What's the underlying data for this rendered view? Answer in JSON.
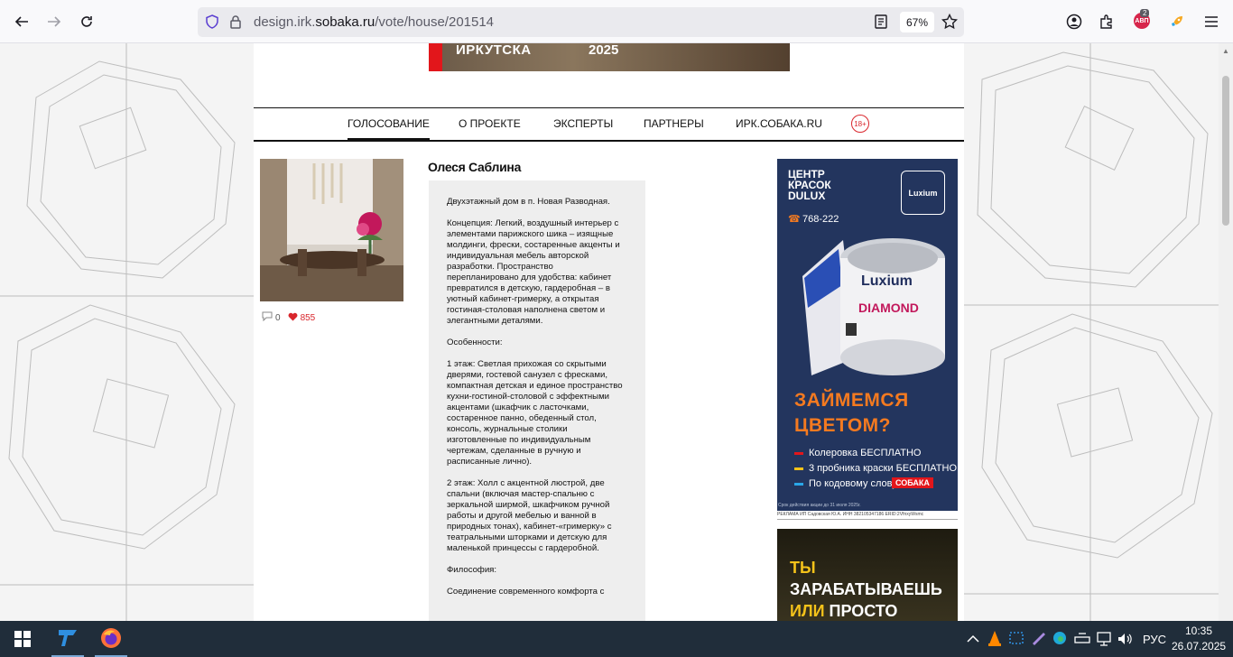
{
  "browser": {
    "url_prefix": "design.irk.",
    "url_domain": "sobaka.ru",
    "url_path": "/vote/house/201514",
    "zoom": "67%",
    "extension_badge": "АВП",
    "extension_count": "2"
  },
  "banner": {
    "text": "ИРКУТСКА",
    "year": "2025"
  },
  "nav": {
    "items": [
      "ГОЛОСОВАНИЕ",
      "О ПРОЕКТЕ",
      "ЭКСПЕРТЫ",
      "ПАРТНЕРЫ",
      "ИРК.СОБАКА.RU"
    ],
    "age": "18+"
  },
  "entry": {
    "author": "Олеся Саблина",
    "comments": "0",
    "likes": "855",
    "paragraphs": [
      "Двухэтажный дом в п. Новая Разводная.",
      "Концепция: Легкий, воздушный интерьер с элементами парижского шика – изящные молдинги, фрески, состаренные акценты и индивидуальная мебель авторской разработки. Пространство перепланировано для удобства: кабинет превратился в детскую, гардеробная – в уютный кабинет-гримерку, а открытая гостиная-столовая наполнена светом и элегантными деталями.",
      "Особенности:",
      "1 этаж: Светлая прихожая со скрытыми дверями, гостевой санузел с фресками, компактная детская и единое пространство кухни-гостиной-столовой с эффектными акцентами (шкафчик с ласточками, состаренное панно, обеденный стол, консоль, журнальные столики изготовленные по индивидуальным чертежам, сделанные в ручную и расписанные лично).",
      "2 этаж: Холл с акцентной люстрой, две спальни (включая мастер-спальню с зеркальной ширмой, шкафчиком ручной работы и другой мебелью и ванной в природных тонах), кабинет-«гримерку» с театральными шторками и детскую для маленькой принцессы с гардеробной.",
      "Философия:",
      "Соединение современного комфорта с"
    ]
  },
  "ad1": {
    "brand_line1": "ЦЕНТР",
    "brand_line2": "КРАСОК",
    "brand_line3": "DULUX",
    "phone": "768-222",
    "logo": "Luxium",
    "can_brand": "Luxium",
    "can_product": "DIAMOND",
    "headline_line1": "ЗАЙМЕМСЯ",
    "headline_line2": "ЦВЕТОМ?",
    "bullets": [
      "Колеровка БЕСПЛАТНО",
      "3 пробника краски БЕСПЛАТНО",
      "По кодовому слову"
    ],
    "sobaka": "СОБАКА",
    "fineprint": "Срок действия акции до 31 июля 2025г.",
    "caption": "РЕКЛАМА ИП Садовская Ю.А. ИНН 382105347186 ERID:2VfnxyWsmc",
    "colors": {
      "bg": "#23355e",
      "accent": "#f47a20",
      "red": "#e2161b"
    }
  },
  "ad2": {
    "line1": "ТЫ ЗАРАБАТЫВАЕШЬ",
    "line2_y": "ИЛИ",
    "line2_w": "ПРОСТО УСТАЕШЬ?"
  },
  "taskbar": {
    "lang": "РУС",
    "time": "10:35",
    "date": "26.07.2025"
  }
}
